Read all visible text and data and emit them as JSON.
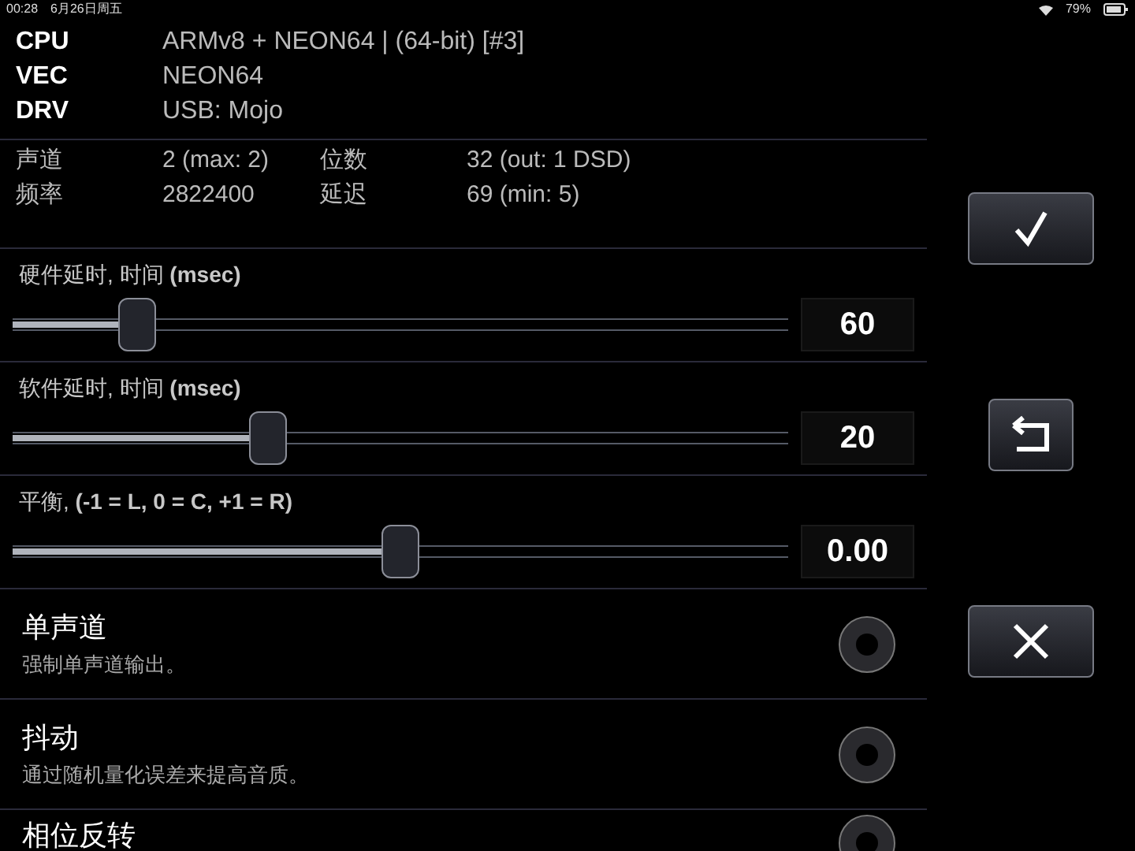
{
  "status_bar": {
    "time": "00:28",
    "date": "6月26日周五",
    "battery": "79%"
  },
  "info": [
    {
      "label": "CPU",
      "value": "ARMv8 + NEON64 | (64-bit) [#3]"
    },
    {
      "label": "VEC",
      "value": "NEON64"
    },
    {
      "label": "DRV",
      "value": "USB: Mojo"
    }
  ],
  "stats": [
    {
      "label": "声道",
      "value": "2 (max: 2)",
      "label2": "位数",
      "value2": "32 (out: 1 DSD)"
    },
    {
      "label": "频率",
      "value": "2822400",
      "label2": "延迟",
      "value2": "69 (min: 5)"
    }
  ],
  "sliders": [
    {
      "label": "硬件延时, 时间 **(msec)**",
      "level": 0.16,
      "value": "60"
    },
    {
      "label": "软件延时, 时间 **(msec)**",
      "level": 0.33,
      "value": "20"
    },
    {
      "label": "平衡, **(-1 = L, 0 = C, +1 = R)**",
      "level": 0.5,
      "value": "0.00"
    }
  ],
  "toggles": [
    {
      "title": "单声道",
      "description": "强制单声道输出。",
      "checked": false
    },
    {
      "title": "抖动",
      "description": "通过随机量化误差来提高音质。",
      "checked": false
    },
    {
      "title": "相位反转",
      "checked": false
    }
  ],
  "actions": [
    {
      "kind": "confirm"
    },
    {
      "kind": "reset"
    },
    {
      "kind": "cancel"
    }
  ]
}
